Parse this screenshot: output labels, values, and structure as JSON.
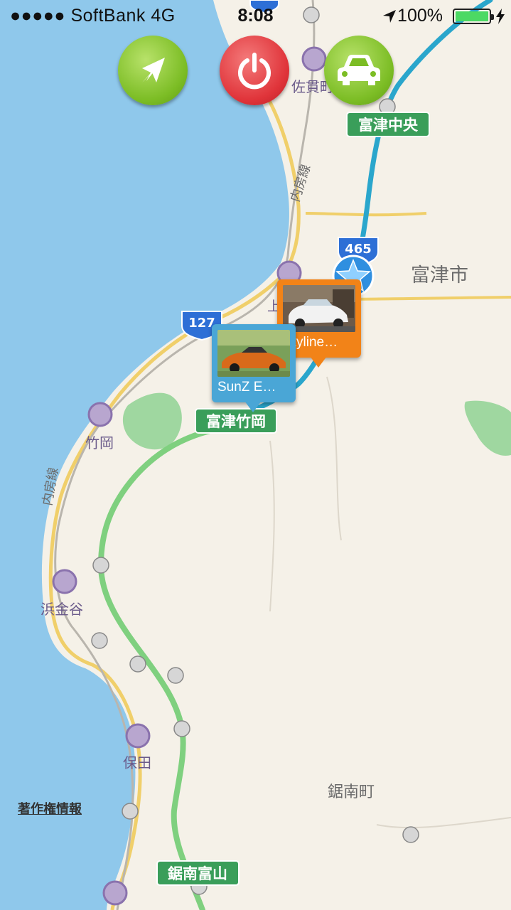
{
  "status_bar": {
    "carrier": "●●●●● SoftBank   4G",
    "time": "8:08",
    "battery": "100%"
  },
  "controls": {
    "locate_icon": "location-arrow-icon",
    "power_icon": "power-icon",
    "car_icon": "car-icon"
  },
  "map": {
    "place_labels": {
      "futtsu_city": "富津市",
      "kyonan_town": "鋸南町",
      "sanukimachi": "佐貫町",
      "takeoka": "竹岡",
      "hamakanaya": "浜金谷",
      "hota": "保田",
      "uchibo_line_1": "内房線",
      "uchibo_line_2": "内房線",
      "kami": "上"
    },
    "interchanges": {
      "futtsu_chuo": "富津中央",
      "futtsu_takeoka": "富津竹岡",
      "kyonan_tomiyama": "鋸南富山"
    },
    "route_shields": {
      "r465": "465",
      "r127": "127"
    },
    "colors": {
      "sea": "#8fc8eb",
      "land": "#f5f1e8",
      "expressway": "#7fd07f",
      "track": "#2aa6cc",
      "shield": "#2d6fd6"
    }
  },
  "pins": {
    "skyline": {
      "label": "skyline…"
    },
    "sunz": {
      "label": "SunZ E…"
    }
  },
  "copyright": "著作権情報"
}
